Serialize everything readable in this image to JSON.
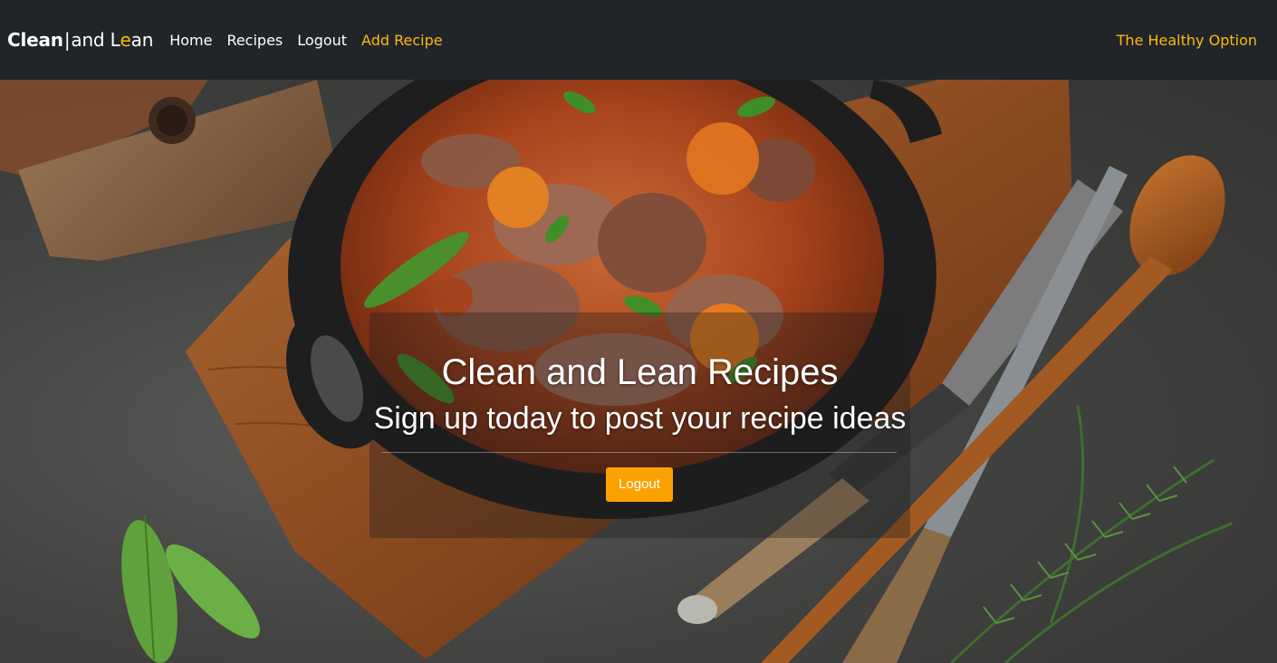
{
  "brand": {
    "part1_a": "C",
    "part1_b": "lean",
    "separator": "|",
    "part2_a": "and L",
    "part2_b": "e",
    "part2_c": "an"
  },
  "nav": {
    "items": [
      {
        "label": "Home"
      },
      {
        "label": "Recipes"
      },
      {
        "label": "Logout"
      },
      {
        "label": "Add Recipe"
      }
    ],
    "right_label": "The Healthy Option"
  },
  "hero": {
    "title": "Clean and Lean Recipes",
    "subtitle": "Sign up today to post your recipe ideas",
    "button_label": "Logout"
  },
  "colors": {
    "navbar_bg": "#212529",
    "accent": "#fdb813",
    "button": "#fba200"
  }
}
